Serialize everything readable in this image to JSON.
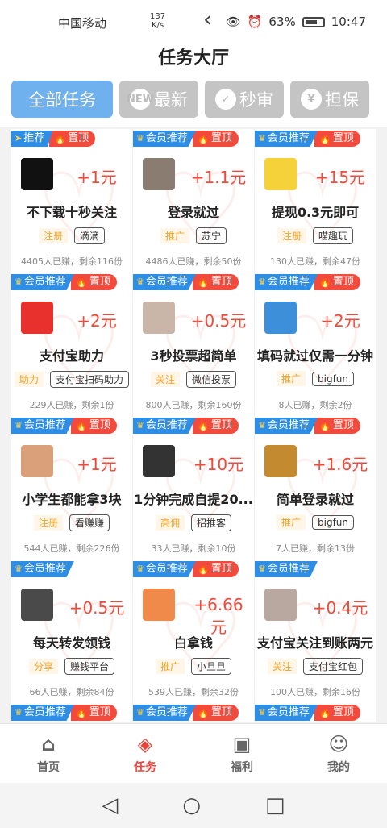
{
  "status": {
    "carrier": "中国移动",
    "net_speed": "137\nK/s",
    "battery": "63%",
    "time": "10:47"
  },
  "page_title": "任务大厅",
  "tabs": [
    {
      "label": "全部任务",
      "icon": ""
    },
    {
      "label": "最新",
      "icon": "NEW"
    },
    {
      "label": "秒审",
      "icon": "✓"
    },
    {
      "label": "担保",
      "icon": "¥"
    }
  ],
  "badges": {
    "member": "会员推荐",
    "recommend": "推荐",
    "top": "置顶"
  },
  "cards": [
    {
      "reward": "+1元",
      "name": "不下载十秒关注",
      "type": "注册",
      "source": "滴滴",
      "stats": "4405人已赚，剩余116份",
      "badge1": "推荐",
      "top": true,
      "thumb": "#111111"
    },
    {
      "reward": "+1.1元",
      "name": "登录就过",
      "type": "推广",
      "source": "苏宁",
      "stats": "4486人已赚，剩余50份",
      "badge1": "会员推荐",
      "top": true,
      "thumb": "#8a7c70"
    },
    {
      "reward": "+15元",
      "name": "提现0.3元即可",
      "type": "注册",
      "source": "喵趣玩",
      "stats": "130人已赚，剩余47份",
      "badge1": "会员推荐",
      "top": true,
      "thumb": "#f5d23a"
    },
    {
      "reward": "+2元",
      "name": "支付宝助力",
      "type": "助力",
      "source": "支付宝扫码助力",
      "stats": "229人已赚，剩余1份",
      "badge1": "会员推荐",
      "top": true,
      "thumb": "#e8302c"
    },
    {
      "reward": "+0.5元",
      "name": "3秒投票超简单",
      "type": "关注",
      "source": "微信投票",
      "stats": "800人已赚，剩余160份",
      "badge1": "会员推荐",
      "top": true,
      "thumb": "#c9b6a8"
    },
    {
      "reward": "+2元",
      "name": "填码就过仅需一分钟",
      "type": "推广",
      "source": "bigfun",
      "stats": "8人已赚，剩余2份",
      "badge1": "会员推荐",
      "top": true,
      "thumb": "#3c8fd8"
    },
    {
      "reward": "+1元",
      "name": "小学生都能拿3块",
      "type": "注册",
      "source": "看赚赚",
      "stats": "544人已赚，剩余226份",
      "badge1": "会员推荐",
      "top": true,
      "thumb": "#d9a07a"
    },
    {
      "reward": "+10元",
      "name": "1分钟完成自提20...",
      "type": "高佣",
      "source": "招推客",
      "stats": "33人已赚，剩余10份",
      "badge1": "会员推荐",
      "top": true,
      "thumb": "#333333"
    },
    {
      "reward": "+1.6元",
      "name": "简单登录就过",
      "type": "推广",
      "source": "bigfun",
      "stats": "7人已赚，剩余13份",
      "badge1": "会员推荐",
      "top": true,
      "thumb": "#c48a30"
    },
    {
      "reward": "+0.5元",
      "name": "每天转发领钱",
      "type": "分享",
      "source": "赚钱平台",
      "stats": "66人已赚，剩余84份",
      "badge1": "会员推荐",
      "top": false,
      "thumb": "#4a4a4a"
    },
    {
      "reward": "+6.66元",
      "name": "白拿钱",
      "type": "推广",
      "source": "小旦旦",
      "stats": "539人已赚，剩余32份",
      "badge1": "会员推荐",
      "top": true,
      "thumb": "#f08a4a"
    },
    {
      "reward": "+0.4元",
      "name": "支付宝关注到账两元",
      "type": "关注",
      "source": "支付宝红包",
      "stats": "100人已赚，剩余16份",
      "badge1": "会员推荐",
      "top": false,
      "thumb": "#b8a8a0"
    },
    {
      "reward": "",
      "name": "",
      "type": "",
      "source": "",
      "stats": "",
      "badge1": "会员推荐",
      "top": true,
      "thumb": ""
    },
    {
      "reward": "",
      "name": "",
      "type": "",
      "source": "",
      "stats": "",
      "badge1": "会员推荐",
      "top": true,
      "thumb": ""
    },
    {
      "reward": "",
      "name": "",
      "type": "",
      "source": "",
      "stats": "",
      "badge1": "会员推荐",
      "top": true,
      "thumb": ""
    }
  ],
  "bottom_nav": [
    {
      "label": "首页",
      "icon": "home-icon",
      "glyph": "⌂"
    },
    {
      "label": "任务",
      "icon": "task-icon",
      "glyph": "◈"
    },
    {
      "label": "福利",
      "icon": "gift-icon",
      "glyph": "▣"
    },
    {
      "label": "我的",
      "icon": "profile-icon",
      "glyph": "☺"
    }
  ],
  "colors": {
    "accent": "#e8443a",
    "tab_active": "#6fb0ef",
    "member_badge": "#2e8de4",
    "top_badge": "#f24a3c"
  }
}
